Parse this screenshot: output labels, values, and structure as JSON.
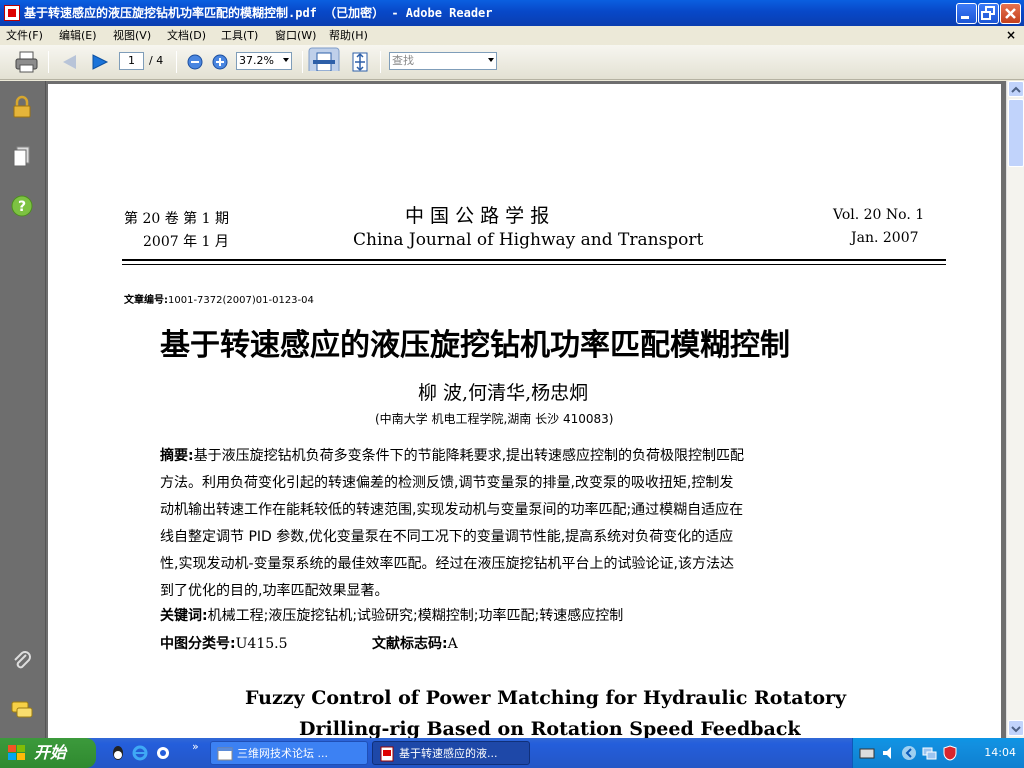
{
  "window": {
    "title": "基于转速感应的液压旋挖钻机功率匹配的模糊控制.pdf （已加密） - Adobe Reader"
  },
  "menu": {
    "items": [
      "文件(F)",
      "编辑(E)",
      "视图(V)",
      "文档(D)",
      "工具(T)",
      "窗口(W)",
      "帮助(H)"
    ],
    "close": "×"
  },
  "toolbar": {
    "page_current": "1",
    "page_total": "/ 4",
    "zoom": "37.2%",
    "search_placeholder": "查找"
  },
  "document": {
    "vol_cn": "第 20 卷   第 1 期",
    "date_cn": "2007 年 1 月",
    "journal_cn": "中  国  公  路  学  报",
    "journal_en": "China Journal of Highway and Transport",
    "vol_en": "Vol. 20   No. 1",
    "date_en": "Jan.  2007",
    "article_no_label": "文章编号:",
    "article_no": "1001-7372(2007)01-0123-04",
    "title_cn": "基于转速感应的液压旋挖钻机功率匹配模糊控制",
    "authors": "柳   波,何清华,杨忠炯",
    "affiliation": "(中南大学  机电工程学院,湖南  长沙   410083)",
    "abstract_label": "摘要:",
    "abstract_lines": [
      "基于液压旋挖钻机负荷多变条件下的节能降耗要求,提出转速感应控制的负荷极限控制匹配",
      "方法。利用负荷变化引起的转速偏差的检测反馈,调节变量泵的排量,改变泵的吸收扭矩,控制发",
      "动机输出转速工作在能耗较低的转速范围,实现发动机与变量泵间的功率匹配;通过模糊自适应在",
      "线自整定调节 PID 参数,优化变量泵在不同工况下的变量调节性能,提高系统对负荷变化的适应",
      "性,实现发动机-变量泵系统的最佳效率匹配。经过在液压旋挖钻机平台上的试验论证,该方法达",
      "到了优化的目的,功率匹配效果显著。"
    ],
    "keywords_label": "关键词:",
    "keywords": "机械工程;液压旋挖钻机;试验研究;模糊控制;功率匹配;转速感应控制",
    "class_label": "中图分类号:",
    "class_value": "U415.5",
    "doc_code_label": "文献标志码:",
    "doc_code_value": "A",
    "title_en_line1": "Fuzzy Control of Power Matching for Hydraulic Rotatory",
    "title_en_line2": "Drilling-rig Based on Rotation Speed Feedback"
  },
  "taskbar": {
    "start": "开始",
    "tasks": [
      "三维网技术论坛 ...",
      "基于转速感应的液..."
    ],
    "clock": "14:04"
  },
  "colors": {
    "titlebar": "#0A5FE0",
    "taskbar": "#245EDB",
    "start": "#3C9A3C",
    "nav_panel": "#6E6E6E"
  }
}
